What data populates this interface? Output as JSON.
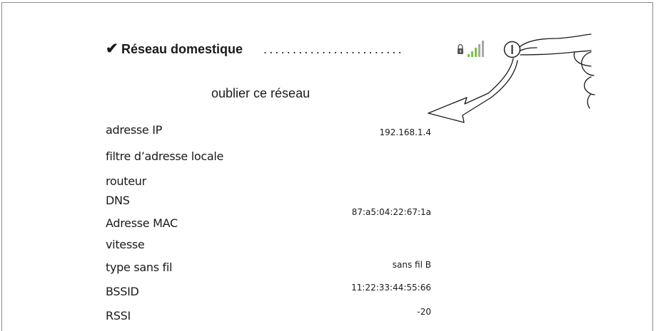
{
  "network": {
    "name": "Réseau domestique",
    "leader": "........................",
    "forget_label": "oublier ce réseau"
  },
  "details": {
    "ip_label": "adresse IP",
    "ip_value": "192.168.1.4",
    "local_filter_label": "filtre d’adresse locale",
    "router_label": "routeur",
    "dns_label": "DNS",
    "mac_label": "Adresse MAC",
    "mac_value": "87:a5:04:22:67:1a",
    "speed_label": "vitesse",
    "wireless_type_label": "type sans fil",
    "wireless_type_value": "sans fil B",
    "bssid_label": "BSSID",
    "bssid_value": "11:22:33:44:55:66",
    "rssi_label": "RSSI",
    "rssi_value": "-20"
  },
  "icons": {
    "check": "checkmark-icon",
    "lock": "lock-icon",
    "signal": "signal-bars-icon",
    "info": "info-button-icon"
  },
  "colors": {
    "signal_active": "#7cc242",
    "signal_inactive": "#a8a8a8"
  }
}
